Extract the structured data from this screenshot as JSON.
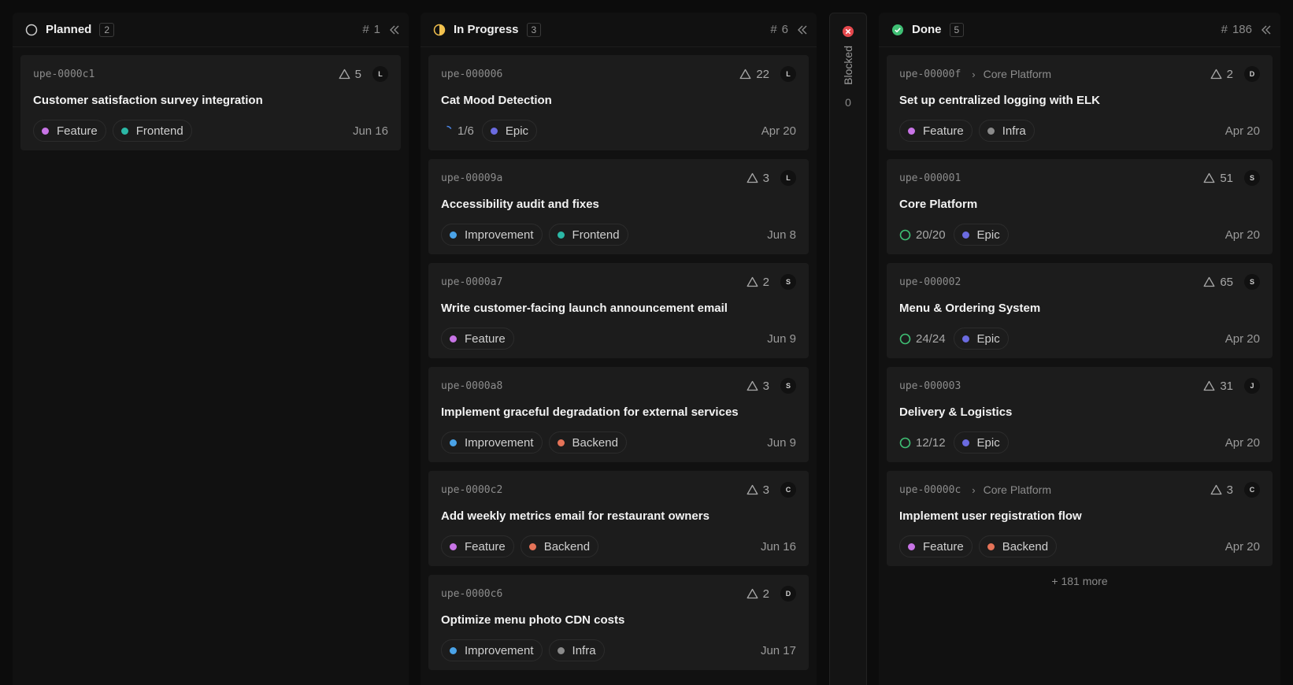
{
  "colors": {
    "feature": "#c874e6",
    "frontend": "#2bb8a6",
    "improvement": "#4aa3e8",
    "backend": "#e57358",
    "infra": "#8a8a8a",
    "epic": "#6b6be0",
    "done_green": "#3fbf74",
    "progress_yellow": "#f2c14e",
    "blocked_red": "#e5484d"
  },
  "columns": {
    "planned": {
      "title": "Planned",
      "count": "2",
      "hash_symbol": "#",
      "hash_value": "1",
      "icon": "circle-outline-icon",
      "cards": [
        {
          "id": "upe-0000c1",
          "points": "5",
          "avatar": "L",
          "title": "Customer satisfaction survey integration",
          "tags": [
            {
              "label": "Feature"
            },
            {
              "label": "Frontend"
            }
          ],
          "date": "Jun 16"
        }
      ]
    },
    "in_progress": {
      "title": "In Progress",
      "count": "3",
      "hash_symbol": "#",
      "hash_value": "6",
      "icon": "half-circle-icon",
      "cards": [
        {
          "id": "upe-000006",
          "points": "22",
          "avatar": "L",
          "title": "Cat Mood Detection",
          "progress": "1/6",
          "tags": [
            {
              "label": "Epic"
            }
          ],
          "date": "Apr 20"
        },
        {
          "id": "upe-00009a",
          "points": "3",
          "avatar": "L",
          "title": "Accessibility audit and fixes",
          "tags": [
            {
              "label": "Improvement"
            },
            {
              "label": "Frontend"
            }
          ],
          "date": "Jun 8"
        },
        {
          "id": "upe-0000a7",
          "points": "2",
          "avatar": "S",
          "title": "Write customer-facing launch announcement email",
          "tags": [
            {
              "label": "Feature"
            }
          ],
          "date": "Jun 9"
        },
        {
          "id": "upe-0000a8",
          "points": "3",
          "avatar": "S",
          "title": "Implement graceful degradation for external services",
          "tags": [
            {
              "label": "Improvement"
            },
            {
              "label": "Backend"
            }
          ],
          "date": "Jun 9"
        },
        {
          "id": "upe-0000c2",
          "points": "3",
          "avatar": "C",
          "title": "Add weekly metrics email for restaurant owners",
          "tags": [
            {
              "label": "Feature"
            },
            {
              "label": "Backend"
            }
          ],
          "date": "Jun 16"
        },
        {
          "id": "upe-0000c6",
          "points": "2",
          "avatar": "D",
          "title": "Optimize menu photo CDN costs",
          "tags": [
            {
              "label": "Improvement"
            },
            {
              "label": "Infra"
            }
          ],
          "date": "Jun 17"
        }
      ]
    },
    "blocked": {
      "title": "Blocked",
      "count": "0",
      "icon": "x-circle-icon"
    },
    "done": {
      "title": "Done",
      "count": "5",
      "hash_symbol": "#",
      "hash_value": "186",
      "icon": "check-circle-icon",
      "more": "+ 181 more",
      "cards": [
        {
          "id": "upe-00000f",
          "parent": "Core Platform",
          "points": "2",
          "avatar": "D",
          "title": "Set up centralized logging with ELK",
          "tags": [
            {
              "label": "Feature"
            },
            {
              "label": "Infra"
            }
          ],
          "date": "Apr 20"
        },
        {
          "id": "upe-000001",
          "points": "51",
          "avatar": "S",
          "title": "Core Platform",
          "progress": "20/20",
          "tags": [
            {
              "label": "Epic"
            }
          ],
          "date": "Apr 20"
        },
        {
          "id": "upe-000002",
          "points": "65",
          "avatar": "S",
          "title": "Menu & Ordering System",
          "progress": "24/24",
          "tags": [
            {
              "label": "Epic"
            }
          ],
          "date": "Apr 20"
        },
        {
          "id": "upe-000003",
          "points": "31",
          "avatar": "J",
          "title": "Delivery & Logistics",
          "progress": "12/12",
          "tags": [
            {
              "label": "Epic"
            }
          ],
          "date": "Apr 20"
        },
        {
          "id": "upe-00000c",
          "parent": "Core Platform",
          "points": "3",
          "avatar": "C",
          "title": "Implement user registration flow",
          "tags": [
            {
              "label": "Feature"
            },
            {
              "label": "Backend"
            }
          ],
          "date": "Apr 20"
        }
      ]
    }
  }
}
